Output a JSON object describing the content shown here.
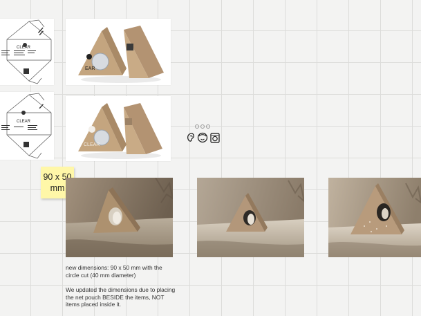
{
  "sticky_note": {
    "line1": "90 x 50",
    "line2": "mm"
  },
  "notes": {
    "paragraph1": "new dimensions: 90 x 50 mm with the circle cut (40 mm diameter)",
    "paragraph2": "We updated the dimensions due to placing the net pouch BESIDE the items, NOT items placed inside it."
  },
  "packaging": {
    "brand": "CLEAR",
    "brand_short": "EAR"
  },
  "icons": [
    "ear-icon",
    "face-icon",
    "washing-machine-icon"
  ],
  "colors": {
    "canvas": "#f3f3f2",
    "grid": "#dcdcda",
    "sticky": "#fff7a8",
    "kraft": "#c4a57f"
  }
}
